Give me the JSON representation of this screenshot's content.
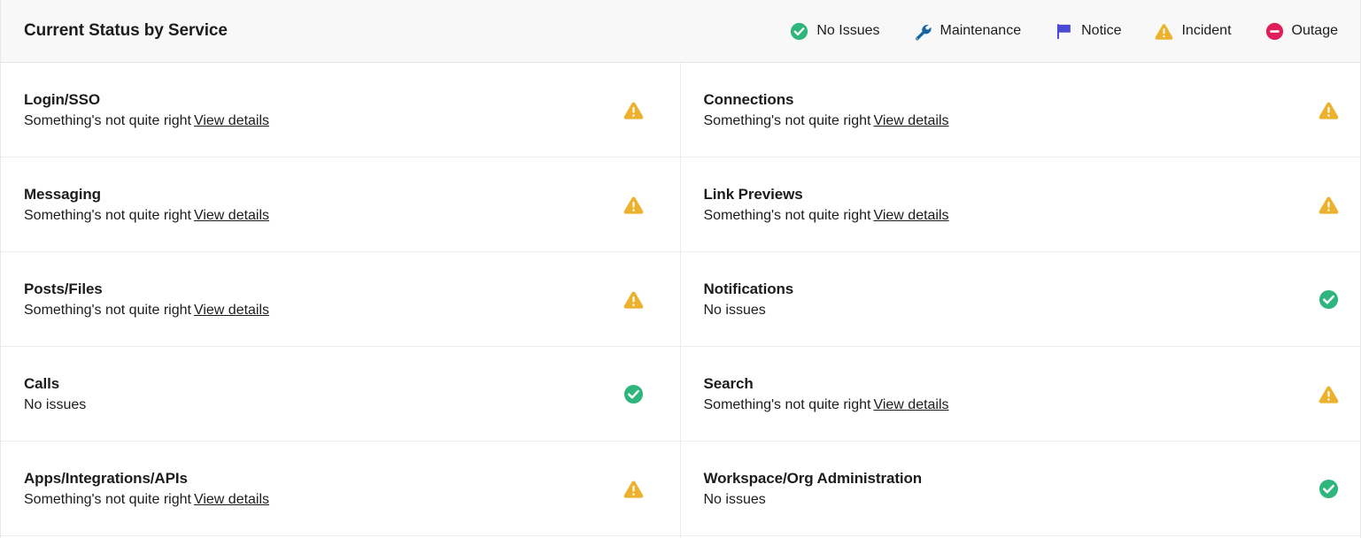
{
  "header": {
    "title": "Current Status by Service",
    "legend": [
      {
        "label": "No Issues",
        "icon": "check-circle-icon",
        "color": "#2eb67d"
      },
      {
        "label": "Maintenance",
        "icon": "wrench-icon",
        "color": "#1264a3"
      },
      {
        "label": "Notice",
        "icon": "flag-icon",
        "color": "#4a4ad4"
      },
      {
        "label": "Incident",
        "icon": "warning-triangle-icon",
        "color": "#ecb22e"
      },
      {
        "label": "Outage",
        "icon": "minus-circle-icon",
        "color": "#e01e5a"
      }
    ]
  },
  "services": {
    "left": [
      {
        "name": "Login/SSO",
        "status_text": "Something's not quite right",
        "link_label": "View details",
        "icon": "warning-triangle-icon"
      },
      {
        "name": "Messaging",
        "status_text": "Something's not quite right",
        "link_label": "View details",
        "icon": "warning-triangle-icon"
      },
      {
        "name": "Posts/Files",
        "status_text": "Something's not quite right",
        "link_label": "View details",
        "icon": "warning-triangle-icon"
      },
      {
        "name": "Calls",
        "status_text": "No issues",
        "link_label": "",
        "icon": "check-circle-icon"
      },
      {
        "name": "Apps/Integrations/APIs",
        "status_text": "Something's not quite right",
        "link_label": "View details",
        "icon": "warning-triangle-icon"
      }
    ],
    "right": [
      {
        "name": "Connections",
        "status_text": "Something's not quite right",
        "link_label": "View details",
        "icon": "warning-triangle-icon"
      },
      {
        "name": "Link Previews",
        "status_text": "Something's not quite right",
        "link_label": "View details",
        "icon": "warning-triangle-icon"
      },
      {
        "name": "Notifications",
        "status_text": "No issues",
        "link_label": "",
        "icon": "check-circle-icon"
      },
      {
        "name": "Search",
        "status_text": "Something's not quite right",
        "link_label": "View details",
        "icon": "warning-triangle-icon"
      },
      {
        "name": "Workspace/Org Administration",
        "status_text": "No issues",
        "link_label": "",
        "icon": "check-circle-icon"
      }
    ]
  },
  "colors": {
    "ok": "#2eb67d",
    "incident": "#ecb22e",
    "outage": "#e01e5a",
    "maintenance": "#1264a3",
    "notice": "#4a4ad4",
    "header_bg": "#f8f8f8",
    "divider": "#ececec",
    "text": "#1d1c1d"
  }
}
